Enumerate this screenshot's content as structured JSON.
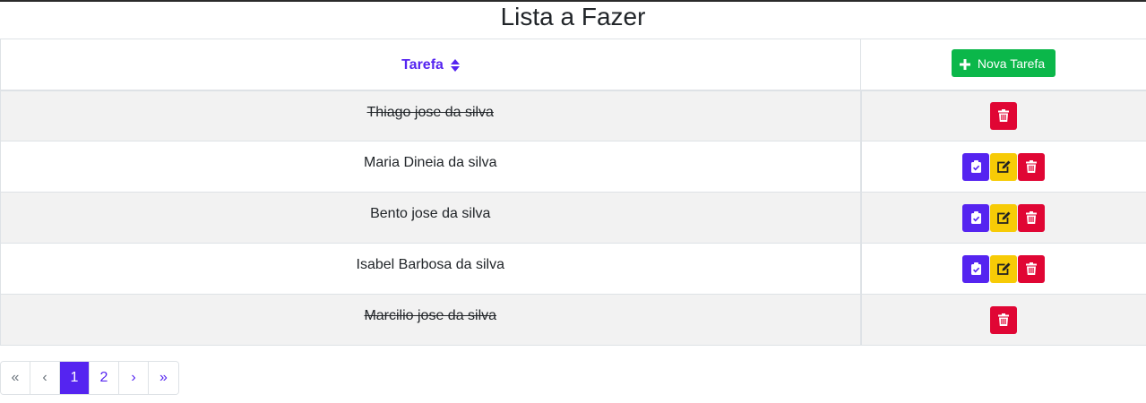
{
  "page": {
    "title": "Lista a Fazer"
  },
  "table": {
    "header": {
      "task_label": "Tarefa",
      "new_task_label": "Nova Tarefa"
    },
    "rows": [
      {
        "text": "Thiago jose da silva",
        "done": true
      },
      {
        "text": "Maria Dineia da silva",
        "done": false
      },
      {
        "text": "Bento jose da silva",
        "done": false
      },
      {
        "text": "Isabel Barbosa da silva",
        "done": false
      },
      {
        "text": "Marcilio jose da silva",
        "done": true
      }
    ]
  },
  "pagination": {
    "first": "«",
    "prev": "‹",
    "pages": [
      "1",
      "2"
    ],
    "active_page": "1",
    "next": "›",
    "last": "»"
  },
  "colors": {
    "primary": "#5524f0",
    "success": "#0bb74a",
    "warning": "#f7cb06",
    "danger": "#e00634"
  },
  "icons": {
    "sort": "sort-icon",
    "add": "plus-icon",
    "complete": "clipboard-check-icon",
    "edit": "edit-icon",
    "delete": "trash-icon"
  }
}
